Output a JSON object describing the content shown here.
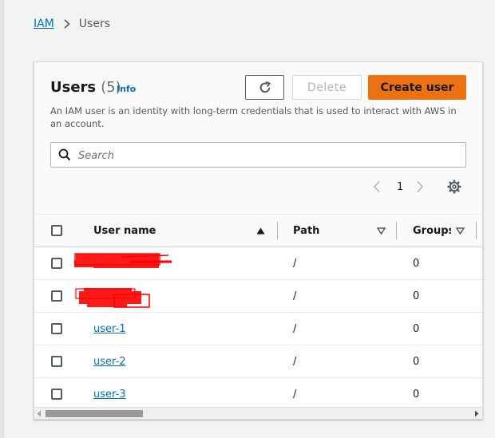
{
  "breadcrumb": {
    "root": "IAM",
    "current": "Users"
  },
  "panel": {
    "title": "Users",
    "count": "(5)",
    "info": "Info",
    "description": "An IAM user is an identity with long-term credentials that is used to interact with AWS in an account.",
    "buttons": {
      "refresh_icon": "refresh-icon",
      "delete": "Delete",
      "create": "Create user"
    },
    "search": {
      "placeholder": "Search",
      "value": ""
    },
    "pagination": {
      "current_page": "1"
    }
  },
  "table": {
    "columns": {
      "user_name": "User name",
      "path": "Path",
      "groups": "Groups"
    },
    "rows": [
      {
        "user_name": "",
        "redacted": true,
        "path": "/",
        "groups": "0"
      },
      {
        "user_name": "",
        "redacted": true,
        "path": "/",
        "groups": "0"
      },
      {
        "user_name": "user-1",
        "redacted": false,
        "path": "/",
        "groups": "0"
      },
      {
        "user_name": "user-2",
        "redacted": false,
        "path": "/",
        "groups": "0"
      },
      {
        "user_name": "user-3",
        "redacted": false,
        "path": "/",
        "groups": "0"
      }
    ]
  },
  "colors": {
    "accent_orange": "#ec7211",
    "link_blue": "#0073bb",
    "redaction_red": "#ff0000",
    "page_background": "#f2f3f3"
  }
}
